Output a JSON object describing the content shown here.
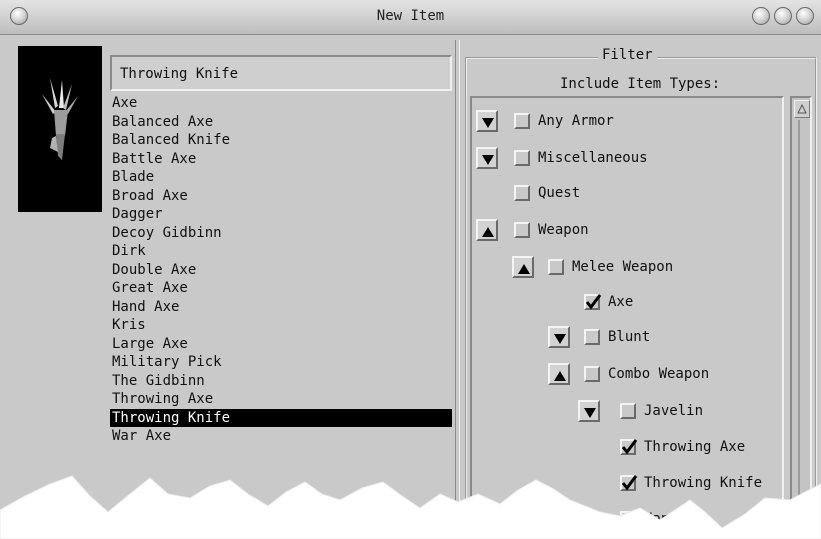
{
  "window": {
    "title": "New Item",
    "icon_name": "throwing-knife-item-icon"
  },
  "name_field": {
    "value": "Throwing Knife"
  },
  "items": [
    {
      "label": "Axe",
      "selected": false
    },
    {
      "label": "Balanced Axe",
      "selected": false
    },
    {
      "label": "Balanced Knife",
      "selected": false
    },
    {
      "label": "Battle Axe",
      "selected": false
    },
    {
      "label": "Blade",
      "selected": false
    },
    {
      "label": "Broad Axe",
      "selected": false
    },
    {
      "label": "Dagger",
      "selected": false
    },
    {
      "label": "Decoy Gidbinn",
      "selected": false
    },
    {
      "label": "Dirk",
      "selected": false
    },
    {
      "label": "Double Axe",
      "selected": false
    },
    {
      "label": "Great Axe",
      "selected": false
    },
    {
      "label": "Hand Axe",
      "selected": false
    },
    {
      "label": "Kris",
      "selected": false
    },
    {
      "label": "Large Axe",
      "selected": false
    },
    {
      "label": "Military Pick",
      "selected": false
    },
    {
      "label": "The Gidbinn",
      "selected": false
    },
    {
      "label": "Throwing Axe",
      "selected": false
    },
    {
      "label": "Throwing Knife",
      "selected": true
    },
    {
      "label": "War Axe",
      "selected": false
    }
  ],
  "filter": {
    "title": "Filter",
    "subtitle": "Include Item Types:",
    "tree": [
      {
        "label": "Any Armor",
        "arrow": "down",
        "checked": false,
        "level": 0
      },
      {
        "label": "Miscellaneous",
        "arrow": "down",
        "checked": false,
        "level": 0
      },
      {
        "label": "Quest",
        "arrow": "none",
        "checked": false,
        "level": 0
      },
      {
        "label": "Weapon",
        "arrow": "up",
        "checked": false,
        "level": 0
      },
      {
        "label": "Melee Weapon",
        "arrow": "up",
        "checked": false,
        "level": 1
      },
      {
        "label": "Axe",
        "arrow": "none",
        "checked": true,
        "level": 2
      },
      {
        "label": "Blunt",
        "arrow": "down",
        "checked": false,
        "level": 2
      },
      {
        "label": "Combo Weapon",
        "arrow": "up",
        "checked": false,
        "level": 2
      },
      {
        "label": "Javelin",
        "arrow": "down",
        "checked": false,
        "level": 3
      },
      {
        "label": "Throwing Axe",
        "arrow": "none",
        "checked": true,
        "level": 4
      },
      {
        "label": "Throwing Knife",
        "arrow": "none",
        "checked": true,
        "level": 4
      },
      {
        "label": "Hand",
        "arrow": "none",
        "checked": false,
        "level": 3,
        "partially_obscured": true
      }
    ]
  }
}
